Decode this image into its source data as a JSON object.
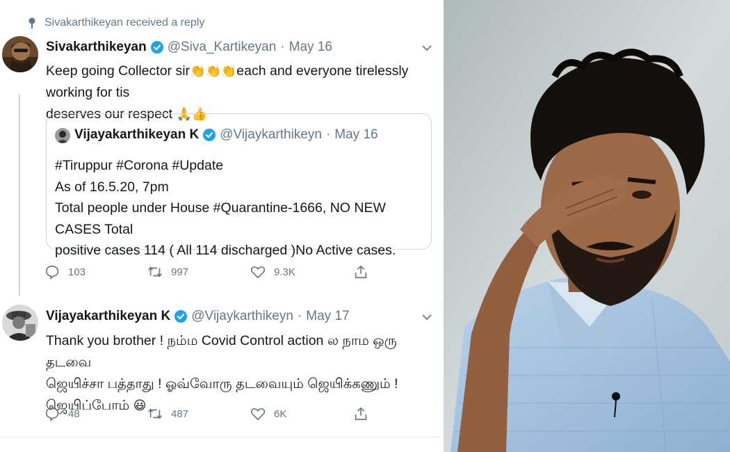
{
  "social_context": "Sivakarthikeyan received a reply",
  "tweet_1": {
    "display_name": "Sivakarthikeyan",
    "handle": "@Siva_Kartikeyan",
    "dot": "·",
    "timestamp": "May 16",
    "text_line_1_a": "Keep going Collector sir",
    "text_line_1_emoji": "👏👏👏",
    "text_line_1_b": "each and everyone tirelessly working for tis",
    "text_line_2": "deserves our respect ",
    "text_line_2_emoji": "🙏👍",
    "quote": {
      "display_name": "Vijayakarthikeyan K",
      "handle": "@Vijaykarthikeyn",
      "dot": "·",
      "timestamp": "May 16",
      "lines": [
        "#Tiruppur #Corona #Update",
        "As of 16.5.20, 7pm",
        "Total people under House #Quarantine-1666, NO NEW CASES Total",
        "positive cases 114 ( All 114 discharged )No Active cases."
      ]
    },
    "replies": "103",
    "retweets": "997",
    "likes": "9.3K"
  },
  "tweet_2": {
    "display_name": "Vijayakarthikeyan K",
    "handle": "@Vijaykarthikeyn",
    "dot": "·",
    "timestamp": "May 17",
    "text_line_1": "Thank you brother ! நம்ம Covid Control action ல நாம ஒரு தடவை",
    "text_line_2": "ஜெயிச்சா பத்தாது ! ஓவ்வோரு தடவையும் ஜெயிக்கணும் !",
    "text_line_3": "ஜெயிப்போம் ",
    "text_line_3_emoji": "😃",
    "replies": "48",
    "retweets": "487",
    "likes": "6K"
  },
  "icons": {
    "pin": "pin-icon",
    "verified": "verified-icon",
    "caret": "chevron-down-icon",
    "reply": "reply-icon",
    "retweet": "retweet-icon",
    "like": "heart-icon",
    "share": "share-icon"
  },
  "colors": {
    "verified_blue": "#1da1f2",
    "text_primary": "#14171a",
    "text_secondary": "#657786",
    "border": "#ccd6dd"
  }
}
